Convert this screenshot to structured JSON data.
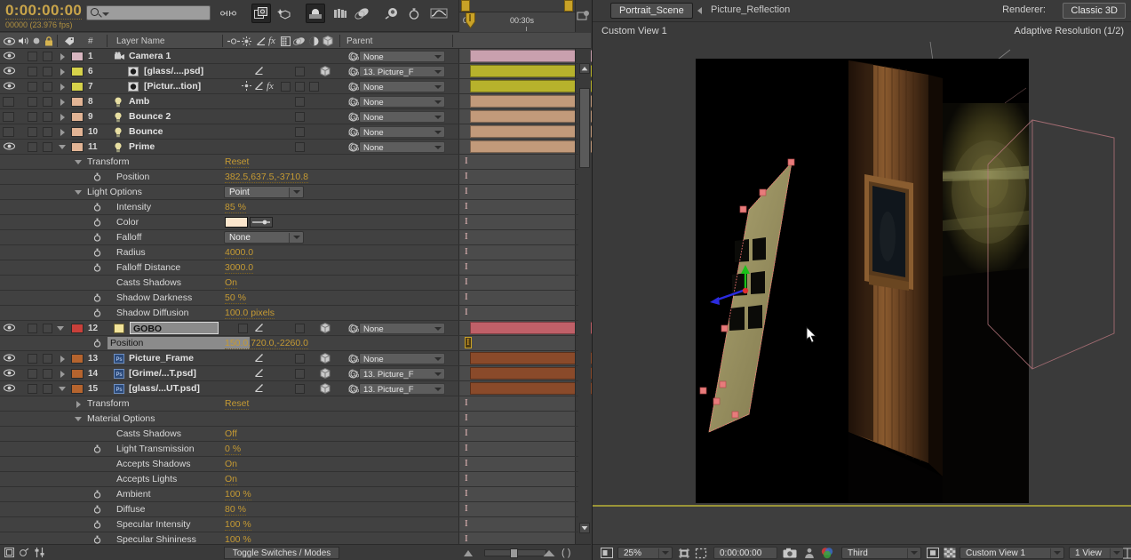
{
  "timeline": {
    "timecode": "0:00:00:00",
    "frames_fps": "00000 (23.976 fps)",
    "search_placeholder": "",
    "ruler": {
      "start_label": "0s",
      "mid_label": "00:30s"
    },
    "columns": [
      "#",
      "Layer Name",
      "Parent"
    ],
    "toggle_switches": "Toggle Switches / Modes",
    "layers": [
      {
        "index": "1",
        "name": "Camera 1",
        "color": "#d8b6c0",
        "parent": "None",
        "bar": "#c9a0ae",
        "type": "camera",
        "expanded": false,
        "visible": true,
        "src_icons": []
      },
      {
        "index": "6",
        "name": "[glass/....psd]",
        "color": "#d6d24a",
        "parent": "13. Picture_F",
        "bar": "#b7b22c",
        "type": "psd",
        "expanded": false,
        "visible": true,
        "src_icons": [
          "ps",
          "mask"
        ]
      },
      {
        "index": "7",
        "name": "[Pictur...tion]",
        "color": "#d6d24a",
        "parent": "None",
        "bar": "#b7b22c",
        "type": "comp",
        "expanded": false,
        "visible": true,
        "src_icons": [
          "film",
          "mask"
        ]
      },
      {
        "index": "8",
        "name": "Amb",
        "color": "#e2b495",
        "parent": "None",
        "bar": "#c29a7a",
        "type": "light",
        "expanded": false,
        "visible": false,
        "src_icons": []
      },
      {
        "index": "9",
        "name": "Bounce 2",
        "color": "#e2b495",
        "parent": "None",
        "bar": "#c29a7a",
        "type": "light",
        "expanded": false,
        "visible": false,
        "src_icons": []
      },
      {
        "index": "10",
        "name": "Bounce",
        "color": "#e2b495",
        "parent": "None",
        "bar": "#c29a7a",
        "type": "light",
        "expanded": false,
        "visible": false,
        "src_icons": []
      },
      {
        "index": "11",
        "name": "Prime",
        "color": "#e2b495",
        "parent": "None",
        "bar": "#c29a7a",
        "type": "light",
        "expanded": true,
        "visible": true,
        "src_icons": []
      }
    ],
    "prime_props": [
      {
        "label": "Transform",
        "value": "Reset",
        "indent": 86,
        "arrow": "down",
        "stopwatch": false
      },
      {
        "label": "Position",
        "value": "382.5,637.5,-3710.8",
        "indent": 119,
        "arrow": "none",
        "stopwatch": true
      },
      {
        "label": "Light Options",
        "value": "",
        "indent": 86,
        "arrow": "down",
        "stopwatch": false,
        "dropdown": "Point"
      },
      {
        "label": "Intensity",
        "value": "85 %",
        "indent": 119,
        "arrow": "none",
        "stopwatch": true
      },
      {
        "label": "Color",
        "value": "",
        "indent": 119,
        "arrow": "none",
        "stopwatch": true,
        "swatch": "#fbe6cd"
      },
      {
        "label": "Falloff",
        "value": "",
        "indent": 119,
        "arrow": "none",
        "stopwatch": true,
        "dropdown": "None"
      },
      {
        "label": "Radius",
        "value": "4000.0",
        "indent": 119,
        "arrow": "none",
        "stopwatch": true
      },
      {
        "label": "Falloff Distance",
        "value": "3000.0",
        "indent": 119,
        "arrow": "none",
        "stopwatch": true
      },
      {
        "label": "Casts Shadows",
        "value": "On",
        "indent": 119,
        "arrow": "none",
        "stopwatch": false
      },
      {
        "label": "Shadow Darkness",
        "value": "50 %",
        "indent": 119,
        "arrow": "none",
        "stopwatch": true
      },
      {
        "label": "Shadow Diffusion",
        "value": "100.0  pixels",
        "indent": 119,
        "arrow": "none",
        "stopwatch": true
      }
    ],
    "gobo": {
      "index": "12",
      "name": "GOBO",
      "color": "#c9403a",
      "bar": "#c06068",
      "parent": "None",
      "position_label": "Position",
      "position_value": "150.0,720.0,-2260.0"
    },
    "lower_layers": [
      {
        "index": "13",
        "name": "Picture_Frame",
        "color": "#b5642e",
        "parent": "None",
        "bar": "#8a4a2a",
        "expanded": false,
        "visible": true
      },
      {
        "index": "14",
        "name": "[Grime/...T.psd]",
        "color": "#b5642e",
        "parent": "13. Picture_F",
        "bar": "#8a4a2a",
        "expanded": false,
        "visible": true
      },
      {
        "index": "15",
        "name": "[glass/...UT.psd]",
        "color": "#b5642e",
        "parent": "13. Picture_F",
        "bar": "#8a4a2a",
        "expanded": true,
        "visible": true
      }
    ],
    "material_props": [
      {
        "label": "Transform",
        "value": "Reset",
        "indent": 86,
        "arrow": "right",
        "stopwatch": false
      },
      {
        "label": "Material Options",
        "value": "",
        "indent": 86,
        "arrow": "down",
        "stopwatch": false
      },
      {
        "label": "Casts Shadows",
        "value": "Off",
        "indent": 119,
        "arrow": "none",
        "stopwatch": false
      },
      {
        "label": "Light Transmission",
        "value": "0 %",
        "indent": 119,
        "arrow": "none",
        "stopwatch": true
      },
      {
        "label": "Accepts Shadows",
        "value": "On",
        "indent": 119,
        "arrow": "none",
        "stopwatch": false
      },
      {
        "label": "Accepts Lights",
        "value": "On",
        "indent": 119,
        "arrow": "none",
        "stopwatch": false
      },
      {
        "label": "Ambient",
        "value": "100 %",
        "indent": 119,
        "arrow": "none",
        "stopwatch": true
      },
      {
        "label": "Diffuse",
        "value": "80 %",
        "indent": 119,
        "arrow": "none",
        "stopwatch": true
      },
      {
        "label": "Specular Intensity",
        "value": "100 %",
        "indent": 119,
        "arrow": "none",
        "stopwatch": true
      },
      {
        "label": "Specular Shininess",
        "value": "100 %",
        "indent": 119,
        "arrow": "none",
        "stopwatch": true
      }
    ]
  },
  "viewer": {
    "tab_active": "Portrait_Scene",
    "tab_secondary": "Picture_Reflection",
    "renderer_label": "Renderer:",
    "renderer_value": "Classic 3D",
    "view_name": "Custom View 1",
    "resolution_note": "Adaptive Resolution (1/2)",
    "bottom": {
      "zoom": "25%",
      "time": "0:00:00:00",
      "quality": "Third",
      "view_layout_name": "Custom View 1",
      "view_count": "1 View"
    }
  },
  "colors": {
    "accent_value": "#c59a33",
    "panel_bg": "#3a3a3a",
    "row_bg": "#3f3f3f",
    "selection": "#8b8b8b",
    "playhead": "#b03030",
    "marker_yellow": "#c9a227"
  }
}
